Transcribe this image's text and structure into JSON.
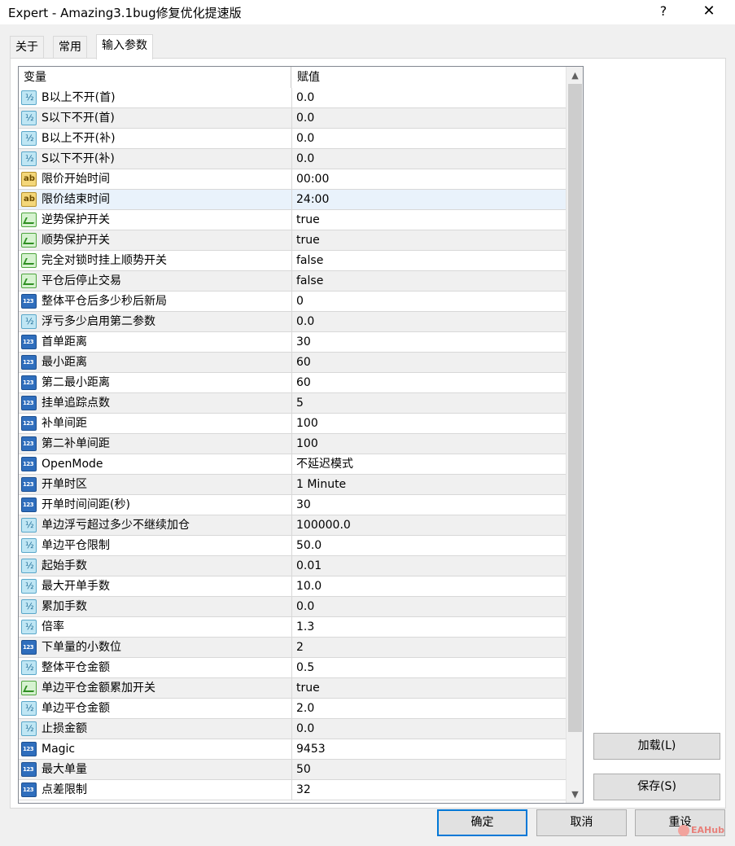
{
  "window": {
    "title": "Expert - Amazing3.1bug修复优化提速版",
    "help": "?",
    "close": "✕"
  },
  "tabs": [
    {
      "label": "关于"
    },
    {
      "label": "常用"
    },
    {
      "label": "输入参数"
    }
  ],
  "grid": {
    "headers": {
      "variable": "变量",
      "value": "赋值"
    },
    "rows": [
      {
        "name": "B以上不开(首)",
        "value": "0.0",
        "type": "frac-icon"
      },
      {
        "name": "S以下不开(首)",
        "value": "0.0",
        "type": "frac-icon"
      },
      {
        "name": "B以上不开(补)",
        "value": "0.0",
        "type": "frac-icon"
      },
      {
        "name": "S以下不开(补)",
        "value": "0.0",
        "type": "frac-icon"
      },
      {
        "name": "限价开始时间",
        "value": "00:00",
        "type": "string-icon"
      },
      {
        "name": "限价结束时间",
        "value": "24:00",
        "type": "string-icon"
      },
      {
        "name": "逆势保护开关",
        "value": "true",
        "type": "bool-icon"
      },
      {
        "name": "顺势保护开关",
        "value": "true",
        "type": "bool-icon"
      },
      {
        "name": "完全对锁时挂上顺势开关",
        "value": "false",
        "type": "bool-icon"
      },
      {
        "name": "平仓后停止交易",
        "value": "false",
        "type": "bool-icon"
      },
      {
        "name": "整体平仓后多少秒后新局",
        "value": "0",
        "type": "int-icon"
      },
      {
        "name": "浮亏多少启用第二参数",
        "value": "0.0",
        "type": "frac-icon"
      },
      {
        "name": "首单距离",
        "value": "30",
        "type": "int-icon"
      },
      {
        "name": "最小距离",
        "value": "60",
        "type": "int-icon"
      },
      {
        "name": "第二最小距离",
        "value": "60",
        "type": "int-icon"
      },
      {
        "name": "挂单追踪点数",
        "value": "5",
        "type": "int-icon"
      },
      {
        "name": "补单间距",
        "value": "100",
        "type": "int-icon"
      },
      {
        "name": "第二补单间距",
        "value": "100",
        "type": "int-icon"
      },
      {
        "name": "OpenMode",
        "value": "不延迟模式",
        "type": "int-icon"
      },
      {
        "name": "开单时区",
        "value": "1 Minute",
        "type": "int-icon"
      },
      {
        "name": "开单时间间距(秒)",
        "value": "30",
        "type": "int-icon"
      },
      {
        "name": "单边浮亏超过多少不继续加仓",
        "value": "100000.0",
        "type": "frac-icon"
      },
      {
        "name": "单边平仓限制",
        "value": "50.0",
        "type": "frac-icon"
      },
      {
        "name": "起始手数",
        "value": "0.01",
        "type": "frac-icon"
      },
      {
        "name": "最大开单手数",
        "value": "10.0",
        "type": "frac-icon"
      },
      {
        "name": "累加手数",
        "value": "0.0",
        "type": "frac-icon"
      },
      {
        "name": "倍率",
        "value": "1.3",
        "type": "frac-icon"
      },
      {
        "name": "下单量的小数位",
        "value": "2",
        "type": "int-icon"
      },
      {
        "name": "整体平仓金额",
        "value": "0.5",
        "type": "frac-icon"
      },
      {
        "name": "单边平仓金额累加开关",
        "value": "true",
        "type": "bool-icon"
      },
      {
        "name": "单边平仓金额",
        "value": "2.0",
        "type": "frac-icon"
      },
      {
        "name": "止损金额",
        "value": "0.0",
        "type": "frac-icon"
      },
      {
        "name": "Magic",
        "value": "9453",
        "type": "int-icon"
      },
      {
        "name": "最大单量",
        "value": "50",
        "type": "int-icon"
      },
      {
        "name": "点差限制",
        "value": "32",
        "type": "int-icon"
      }
    ]
  },
  "buttons": {
    "load": "加载(L)",
    "save": "保存(S)",
    "ok": "确定",
    "cancel": "取消",
    "reset": "重设"
  },
  "scrollbar": {
    "up": "▲",
    "down": "▼"
  },
  "watermark": "EAHub"
}
